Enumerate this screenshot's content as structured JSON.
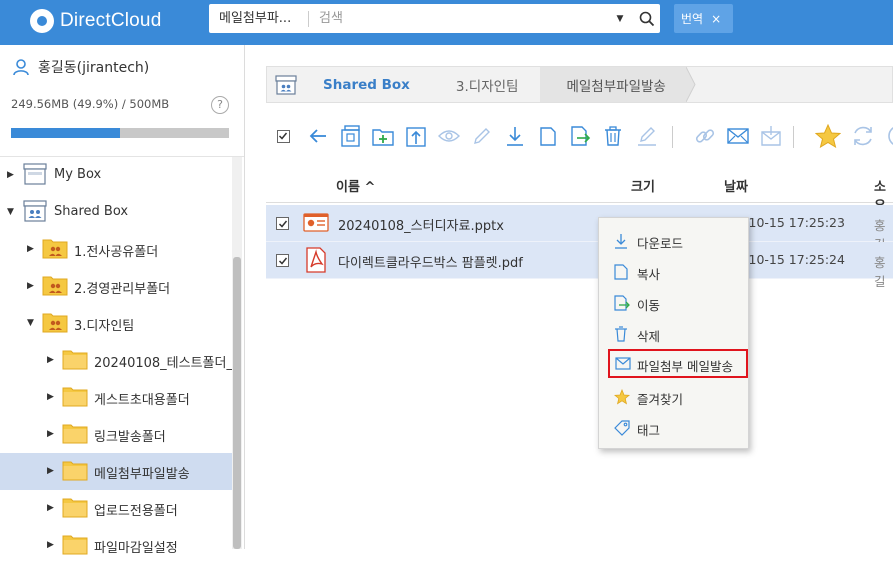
{
  "app": {
    "brand": "DirectCloud"
  },
  "search": {
    "scope": "메일첨부파...",
    "placeholder": "검색"
  },
  "translate": {
    "label": "번역",
    "close": "×"
  },
  "sidebar": {
    "user": "홍길동(jirantech)",
    "storage": "249.56MB (49.9%) / 500MB",
    "help": "?",
    "usage_fraction": 0.499,
    "tree": [
      {
        "label": "My Box",
        "kind": "box",
        "level": 0,
        "arrow": "right"
      },
      {
        "label": "Shared Box",
        "kind": "sharedbox",
        "level": 0,
        "arrow": "down"
      },
      {
        "label": "1.전사공유폴더",
        "kind": "shared-folder",
        "level": 1,
        "arrow": "right"
      },
      {
        "label": "2.경영관리부폴더",
        "kind": "shared-folder",
        "level": 1,
        "arrow": "right"
      },
      {
        "label": "3.디자인팀",
        "kind": "shared-folder",
        "level": 1,
        "arrow": "down"
      },
      {
        "label": "20240108_테스트폴더_(",
        "kind": "folder",
        "level": 2,
        "arrow": "right"
      },
      {
        "label": "게스트초대용폴더",
        "kind": "folder",
        "level": 2,
        "arrow": "right"
      },
      {
        "label": "링크발송폴더",
        "kind": "folder",
        "level": 2,
        "arrow": "right"
      },
      {
        "label": "메일첨부파일발송",
        "kind": "folder",
        "level": 2,
        "arrow": "right",
        "selected": true
      },
      {
        "label": "업로드전용폴더",
        "kind": "folder",
        "level": 2,
        "arrow": "right"
      },
      {
        "label": "파일마감일설정",
        "kind": "folder",
        "level": 2,
        "arrow": "right"
      }
    ]
  },
  "breadcrumb": [
    "Shared Box",
    "3.디자인팀",
    "메일첨부파일발송"
  ],
  "toolbar": [
    "select-all-checkbox",
    "back-arrow-icon",
    "new-box-icon",
    "new-folder-icon",
    "upload-icon",
    "view-icon",
    "edit-icon",
    "download-icon",
    "copy-icon",
    "move-icon",
    "delete-icon",
    "rename-icon",
    "link-icon",
    "mail-icon",
    "mail-attach-icon",
    "favorite-icon",
    "refresh-icon",
    "info-icon"
  ],
  "list": {
    "headers": {
      "name": "이름 ^",
      "size": "크기",
      "date": "날짜",
      "owner": "소유"
    },
    "rows": [
      {
        "name": "20240108_스터디자료.pptx",
        "type": "pptx",
        "date": "-10-15 17:25:23",
        "owner": "홍길",
        "checked": true
      },
      {
        "name": "다이렉트클라우드박스 팜플렛.pdf",
        "type": "pdf",
        "date": "-10-15 17:25:24",
        "owner": "홍길",
        "checked": true
      }
    ]
  },
  "context_menu": [
    {
      "label": "다운로드",
      "icon": "download-icon"
    },
    {
      "label": "복사",
      "icon": "copy-icon"
    },
    {
      "label": "이동",
      "icon": "move-icon"
    },
    {
      "label": "삭제",
      "icon": "trash-icon"
    },
    {
      "label": "파일첨부 메일발송",
      "icon": "mail-icon",
      "highlighted": true
    },
    {
      "label": "즐겨찾기",
      "icon": "star-icon"
    },
    {
      "label": "태그",
      "icon": "tag-icon"
    }
  ],
  "colors": {
    "header": "#3a8ad8",
    "selected_row": "#dce6f6",
    "highlight_border": "#e0141d",
    "folder": "#f5c842"
  }
}
